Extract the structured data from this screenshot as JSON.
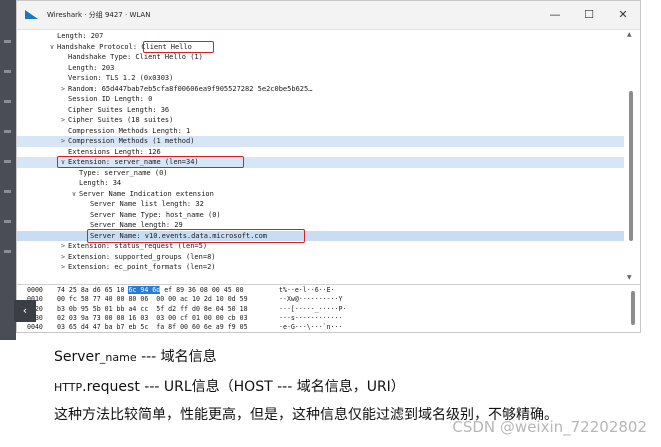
{
  "window": {
    "title": "Wireshark · 分组 9427 · WLAN",
    "buttons": [
      "—",
      "☐",
      "✕"
    ]
  },
  "tree_rows": [
    {
      "indent": 0,
      "twisty": "",
      "text": "Length: 207"
    },
    {
      "indent": 0,
      "twisty": "∨",
      "text": "Handshake Protocol: Client Hello"
    },
    {
      "indent": 1,
      "twisty": "",
      "text": "Handshake Type: Client Hello (1)"
    },
    {
      "indent": 1,
      "twisty": "",
      "text": "Length: 203"
    },
    {
      "indent": 1,
      "twisty": "",
      "text": "Version: TLS 1.2 (0x0303)"
    },
    {
      "indent": 1,
      "twisty": ">",
      "text": "Random: 65d447bab7eb5cfa8f00606ea9f905527282 5e2c0be5b625…"
    },
    {
      "indent": 1,
      "twisty": "",
      "text": "Session ID Length: 0"
    },
    {
      "indent": 1,
      "twisty": "",
      "text": "Cipher Suites Length: 36"
    },
    {
      "indent": 1,
      "twisty": ">",
      "text": "Cipher Suites (18 suites)"
    },
    {
      "indent": 1,
      "twisty": "",
      "text": "Compression Methods Length: 1"
    },
    {
      "indent": 1,
      "twisty": ">",
      "text": "Compression Methods (1 method)"
    },
    {
      "indent": 1,
      "twisty": "",
      "text": "Extensions Length: 126"
    },
    {
      "indent": 1,
      "twisty": "∨",
      "text": "Extension: server_name (len=34)"
    },
    {
      "indent": 2,
      "twisty": "",
      "text": "Type: server_name (0)"
    },
    {
      "indent": 2,
      "twisty": "",
      "text": "Length: 34"
    },
    {
      "indent": 2,
      "twisty": "∨",
      "text": "Server Name Indication extension"
    },
    {
      "indent": 3,
      "twisty": "",
      "text": "Server Name list length: 32"
    },
    {
      "indent": 3,
      "twisty": "",
      "text": "Server Name Type: host_name (0)"
    },
    {
      "indent": 3,
      "twisty": "",
      "text": "Server Name length: 29"
    },
    {
      "indent": 3,
      "twisty": "",
      "text": "Server Name: v10.events.data.microsoft.com"
    },
    {
      "indent": 1,
      "twisty": ">",
      "text": "Extension: status_request (len=5)"
    },
    {
      "indent": 1,
      "twisty": ">",
      "text": "Extension: supported_groups (len=8)"
    },
    {
      "indent": 1,
      "twisty": ">",
      "text": "Extension: ec_point_formats (len=2)"
    }
  ],
  "highlighted_label": "Client Hello",
  "hex_rows": [
    {
      "offset": "0000",
      "pre": "74 25 8a d6 65 10 ",
      "hl": "6c 94 6d",
      "post": " ef 89 36 08 00 45 00",
      "ascii": "t%··e·l··6··E·"
    },
    {
      "offset": "0010",
      "pre": "00 fc 58 77 40 00 80 06  00 00 ac 10 2d 10 0d 59",
      "hl": "",
      "post": "",
      "ascii": "··Xw@·······-··Y"
    },
    {
      "offset": "0020",
      "pre": "b3 0b 95 5b 01 bb a4 cc  5f d2 ff d0 8e 04 50 18",
      "hl": "",
      "post": "",
      "ascii": "···[·····_·····P·"
    },
    {
      "offset": "0030",
      "pre": "02 03 9a 73 00 00 16 03  03 00 cf 01 00 00 cb 03",
      "hl": "",
      "post": "",
      "ascii": "···s············"
    },
    {
      "offset": "0040",
      "pre": "03 65 d4 47 ba b7 eb 5c  fa 8f 00 60 6e a9 f9 05",
      "hl": "",
      "post": "",
      "ascii": "·e·G···\\···`n···"
    }
  ],
  "notes": {
    "line1_a": "Server",
    "line1_b": "_name",
    "line1_c": " --- 域名信息",
    "line2_a": "HTTP",
    "line2_b": ".request --- URL信息（HOST --- 域名信息，URI）",
    "line3": "这种方法比较简单，性能更高，但是，这种信息仅能过滤到域名级别，不够精确。"
  },
  "watermark": "CSDN @weixin_72202802",
  "nav_button": "‹"
}
